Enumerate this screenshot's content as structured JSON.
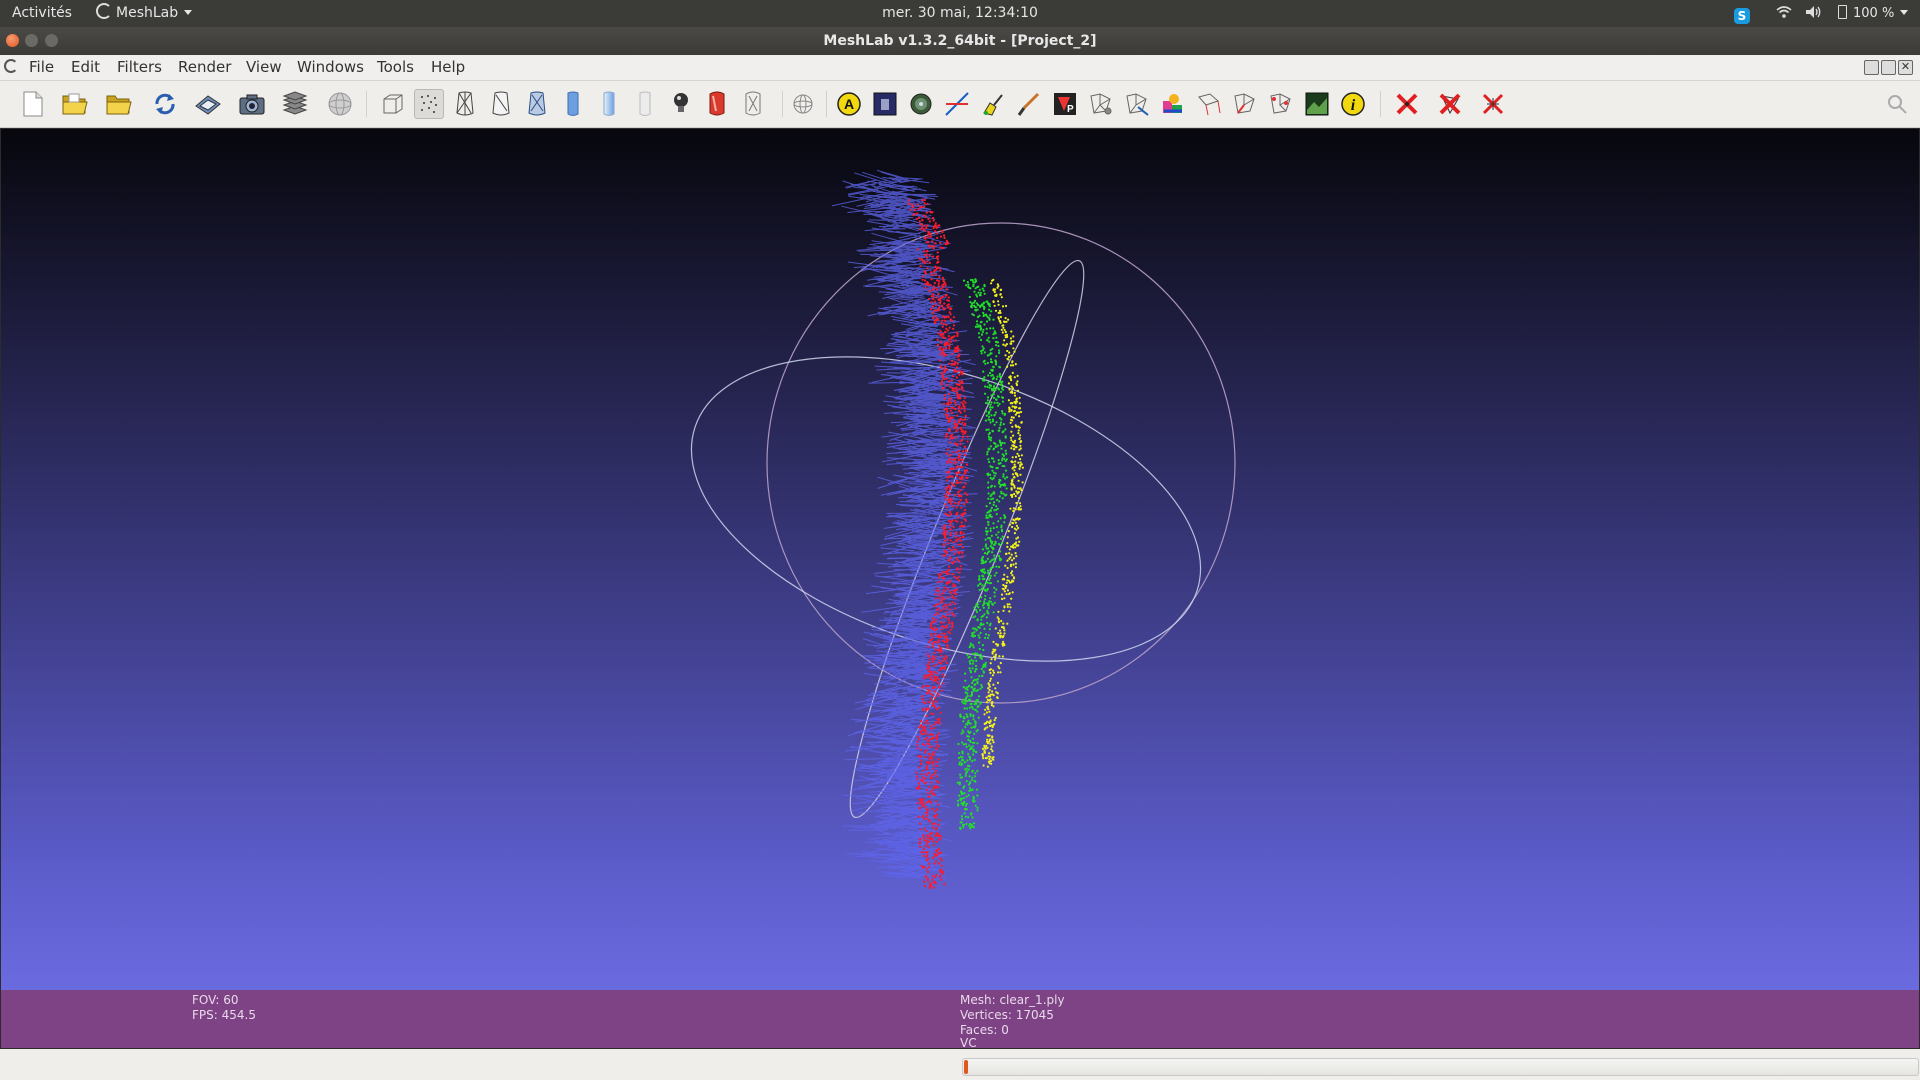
{
  "top_panel": {
    "activities": "Activités",
    "app_name": "MeshLab",
    "clock": "mer. 30 mai, 12:34:10",
    "battery": "100 %"
  },
  "window": {
    "title": "MeshLab v1.3.2_64bit - [Project_2]"
  },
  "menu": [
    "File",
    "Edit",
    "Filters",
    "Render",
    "View",
    "Windows",
    "Tools",
    "Help"
  ],
  "toolbar": {
    "icons": [
      "new-file-icon",
      "open-project-icon",
      "open-mesh-icon",
      "reload-icon",
      "save-snapshot-icon",
      "camera-icon",
      "layers-icon",
      "globe-icon",
      "bounding-box-icon",
      "points-render-icon",
      "wireframe-icon",
      "hidden-lines-icon",
      "flat-lines-icon",
      "flat-icon",
      "smooth-icon",
      "texture-icon",
      "light-icon",
      "fancy-lighting-icon",
      "back-face-icon",
      "trackball-icon",
      "annotation-icon",
      "raster-icon",
      "mesh-info-icon",
      "measure-icon",
      "paint-icon",
      "brush-icon",
      "select-faces-icon",
      "select-vertices-icon",
      "select-connected-icon",
      "color-paint-icon",
      "align-icon",
      "manipulator-icon",
      "pick-points-icon",
      "image-icon",
      "info-icon",
      "delete-vertices-icon",
      "delete-faces-icon",
      "delete-all-icon"
    ]
  },
  "info": {
    "fov": "FOV: 60",
    "fps": "FPS:   454.5",
    "mesh": "Mesh: clear_1.ply",
    "vertices": "Vertices: 17045",
    "faces": "Faces: 0",
    "vc": "VC"
  },
  "progress": {
    "fraction": 0.004
  },
  "colors": {
    "panel": "#3b3b37",
    "infobar": "#7e4384",
    "progress_fill": "#e0561f",
    "accent": "#f07746"
  }
}
